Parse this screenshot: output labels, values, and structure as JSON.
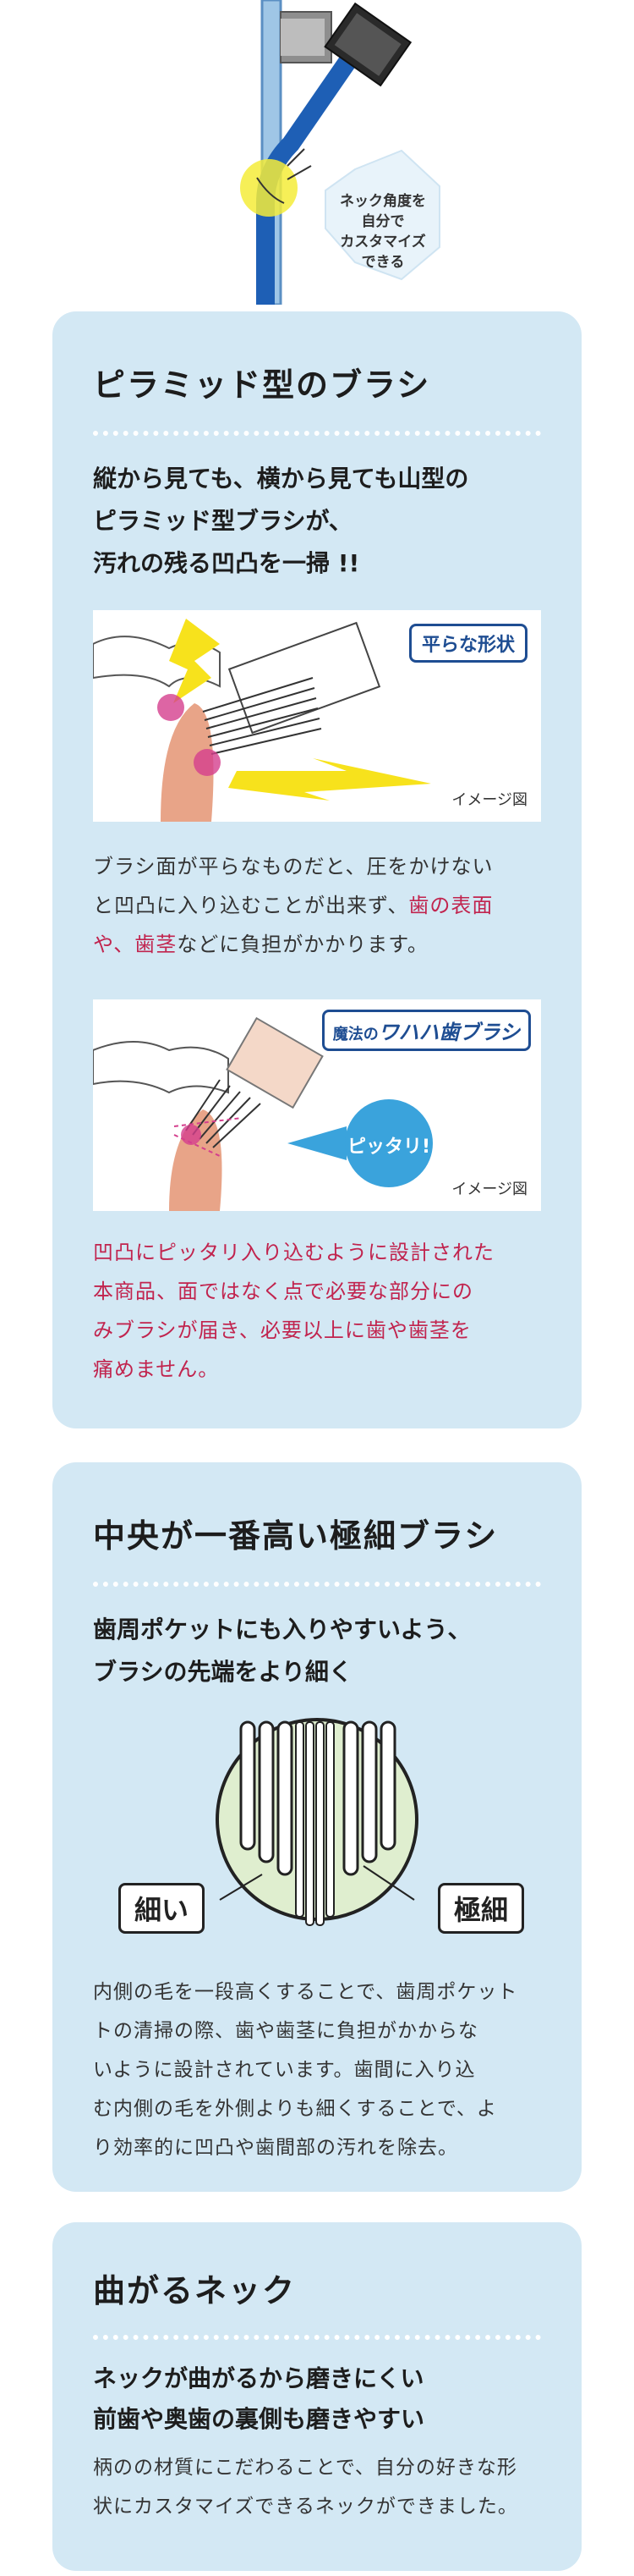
{
  "hero": {
    "bubble_lines": [
      "ネック角度を",
      "自分で",
      "カスタマイズ",
      "できる"
    ]
  },
  "section1": {
    "title": "ピラミッド型のブラシ",
    "lead": [
      "縦から見ても、横から見ても山型の",
      "ピラミッド型ブラシが、",
      "汚れの残る凹凸を一掃 !!"
    ],
    "fig1": {
      "tag": "平らな形状",
      "caption": "イメージ図"
    },
    "text1": {
      "lines": [
        "ブラシ面が平らなものだと、圧をかけない",
        "と凹凸に入り込むことが出来ず、"
      ],
      "hl1": "歯の表面",
      "hl2": "や、歯茎",
      "tail": "などに負担がかかります。"
    },
    "fig2": {
      "tag_prefix": "魔法の",
      "tag_main": "ワハハ歯ブラシ",
      "bubble": "ピッタリ!",
      "caption": "イメージ図"
    },
    "text2": [
      "凹凸にピッタリ入り込むように設計された",
      "本商品、面ではなく点で必要な部分にの",
      "みブラシが届き、必要以上に歯や歯茎を",
      "痛めません。"
    ]
  },
  "section2": {
    "title": "中央が一番高い極細ブラシ",
    "lead": [
      "歯周ポケットにも入りやすいよう、",
      "ブラシの先端をより細く"
    ],
    "label_thin": "細い",
    "label_ultra": "極細",
    "body": [
      "内側の毛を一段高くすることで、歯周ポケット",
      "トの清掃の際、歯や歯茎に負担がかからな",
      "いように設計されています。歯間に入り込",
      "む内側の毛を外側よりも細くすることで、よ",
      "り効率的に凹凸や歯間部の汚れを除去。"
    ]
  },
  "section3": {
    "title": "曲がるネック",
    "lead": [
      "ネックが曲がるから磨きにくい",
      "前歯や奥歯の裏側も磨きやすい"
    ],
    "body": [
      "柄のの材質にこだわることで、自分の好きな形",
      "状にカスタマイズできるネックができました。"
    ]
  },
  "colors": {
    "card_bg": "#d3e8f4",
    "navy": "#1e4d92",
    "accent_pink": "#c1244e",
    "sky": "#3aa3dc"
  }
}
